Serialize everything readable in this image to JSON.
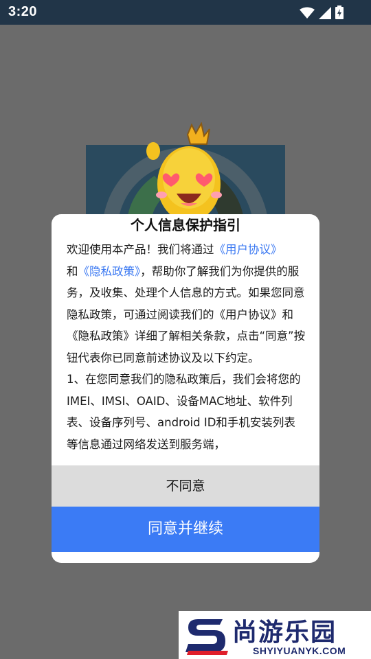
{
  "status_bar": {
    "time": "3:20",
    "icons": [
      "wifi-icon",
      "cell-signal-icon",
      "battery-charging-icon"
    ]
  },
  "dialog": {
    "title": "个人信息保护指引",
    "intro_prefix": "欢迎使用本产品！我们将通过",
    "link_user_agreement": "《用户协议》",
    "connector": "和",
    "link_privacy_policy": "《隐私政策》",
    "intro_rest": "，帮助你了解我们为你提供的服务，及收集、处理个人信息的方式。如果您同意隐私政策，可通过阅读我们的《用户协议》和《隐私政策》详细了解相关条款，点击“同意”按钮代表你已同意前述协议及以下约定。",
    "clause_1": "1、在您同意我们的隐私政策后，我们会将您的IMEI、IMSI、OAID、设备MAC地址、软件列表、设备序列号、android ID和手机安装列表等信息通过网络发送到服务端，",
    "disagree_label": "不同意",
    "agree_label": "同意并继续"
  },
  "watermark": {
    "brand": "尚游乐园",
    "domain": "SHYIYUANYK.COM"
  },
  "colors": {
    "status_bar_bg": "#213548",
    "overlay_bg": "#6b6b6b",
    "link": "#3a78f2",
    "agree_button": "#3b7bf5",
    "disagree_button": "#dcdcdc"
  }
}
